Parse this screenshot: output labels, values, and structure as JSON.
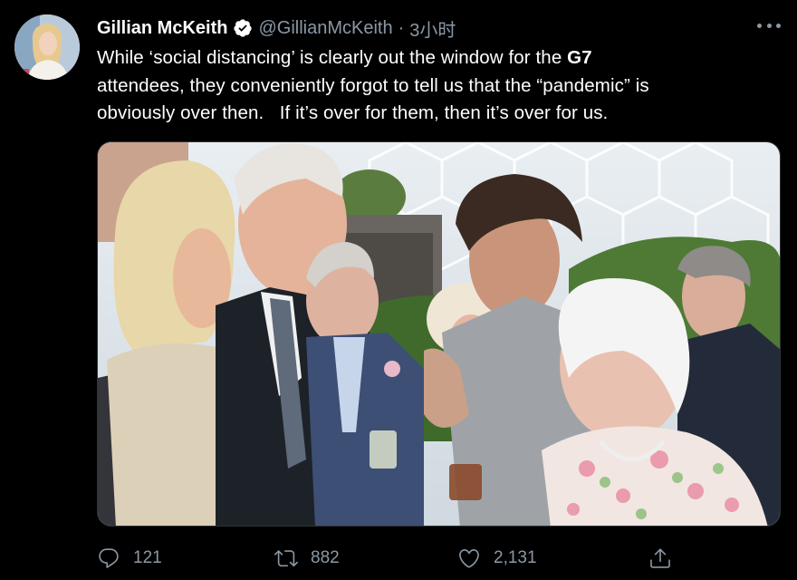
{
  "tweet": {
    "display_name": "Gillian McKeith",
    "handle": "@GillianMcKeith",
    "separator": "·",
    "time": "3小时",
    "text": {
      "line1_before": "While ‘social distancing’ is clearly out the window for the ",
      "line1_bold": "G7",
      "line2": "attendees, they conveniently forgot to tell us that the “pandemic” is",
      "line3": "obviously over then.   If it’s over for them, then it’s over for us."
    }
  },
  "actions": {
    "reply_count": "121",
    "retweet_count": "882",
    "like_count": "2,131"
  },
  "icons": {
    "verified": "verified-badge-icon",
    "more": "more-icon",
    "reply": "reply-icon",
    "retweet": "retweet-icon",
    "like": "heart-icon",
    "share": "share-icon"
  },
  "colors": {
    "background": "#000000",
    "text": "#ffffff",
    "secondary": "#8b98a5",
    "verified": "#ffffff"
  }
}
